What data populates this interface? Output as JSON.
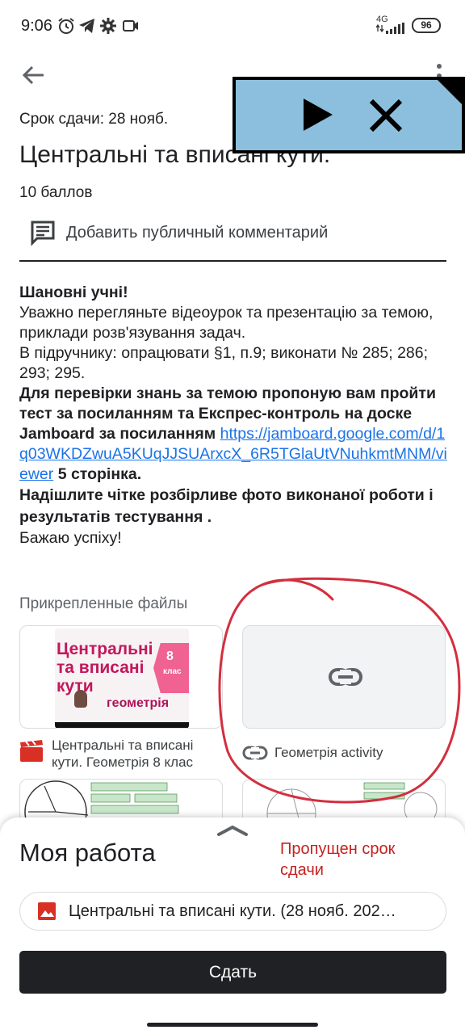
{
  "status_bar": {
    "time": "9:06",
    "network_tag": "4G",
    "battery": "96"
  },
  "assignment": {
    "due": "Срок сдачи: 28 нояб.",
    "title": "Центральні та вписані кути.",
    "points": "10 баллов",
    "comment_label": "Добавить публичный комментарий"
  },
  "instructions": {
    "greeting": "Шановні учні!",
    "line1": "Уважно перегляньте відеоурок та презентацію за темою, приклади розв'язування задач.",
    "line2": "В підручнику: опрацювати §1, п.9; виконати № 285; 286; 293; 295.",
    "bold_part": "Для перевірки знань за темою  пропоную вам  пройти  тест за посиланням та Експрес-контроль на доске Jamboard  за посиланням ",
    "link": "https://jamboard.google.com/d/1q03WKDZwuA5KUqJJSUArxcX_6R5TGlaUtVNuhkmtMNM/viewer",
    "after_link": " 5 сторінка.",
    "send_photo": "Надішлите чітке розбірливе фото виконаної роботи і результатів тестування .",
    "wish": "Бажаю успіху!"
  },
  "attachments": {
    "label": "Прикрепленные файлы",
    "files": [
      {
        "name": "Центральні та вписані кути. Геометрія 8 клас",
        "icon": "video-clapper-icon",
        "thumb_title": "Центральні та вписані кути",
        "thumb_badge_number": "8",
        "thumb_badge_text": "клас",
        "thumb_subject": "геометрія"
      },
      {
        "name": "Геометрія activity",
        "icon": "link-icon"
      }
    ]
  },
  "my_work": {
    "title": "Моя работа",
    "status": "Пропущен срок сдачи",
    "file_chip": "Центральні та вписані кути. (28 нояб. 202…",
    "submit": "Сдать"
  },
  "colors": {
    "accent_link": "#1a73e8",
    "missed": "#c5221f",
    "overlay": "#8cbfdd",
    "annotation": "#d32f3f"
  }
}
